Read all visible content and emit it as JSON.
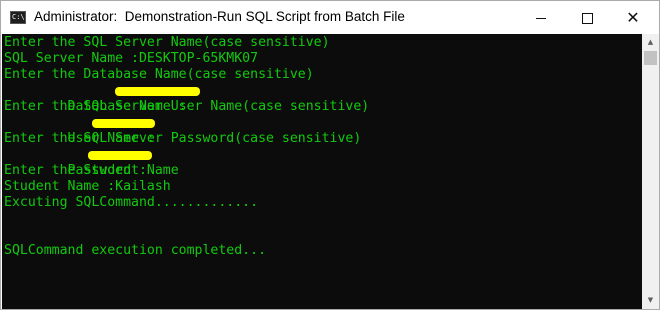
{
  "window": {
    "title": "Administrator:  Demonstration-Run SQL Script from Batch File",
    "icon": "cmd-icon",
    "icon_text": "C:\\."
  },
  "controls": {
    "minimize_icon": "minimize-icon",
    "maximize_icon": "maximize-icon",
    "close_icon": "close-icon",
    "close_glyph": "✕"
  },
  "console": {
    "text_color": "#13c90f",
    "background": "#0c0c0c",
    "lines": [
      "Enter the SQL Server Name(case sensitive)",
      "SQL Server Name :DESKTOP-65KMK07",
      "Enter the Database Name(case sensitive)",
      "Database Name :",
      "Enter the SQL Server User Name(case sensitive)",
      "User Name :",
      "Enter the SQL Server Password(case sensitive)",
      "Password :",
      "Enter the Student Name",
      "Student Name :Kailash",
      "Excuting SQLCommand.............",
      "",
      "",
      "SQLCommand execution completed..."
    ],
    "redaction_color": "#ffff00"
  },
  "scrollbar": {
    "up_arrow_icon": "scroll-up-arrow-icon",
    "down_arrow_icon": "scroll-down-arrow-icon",
    "up_glyph": "▲",
    "down_glyph": "▼"
  }
}
